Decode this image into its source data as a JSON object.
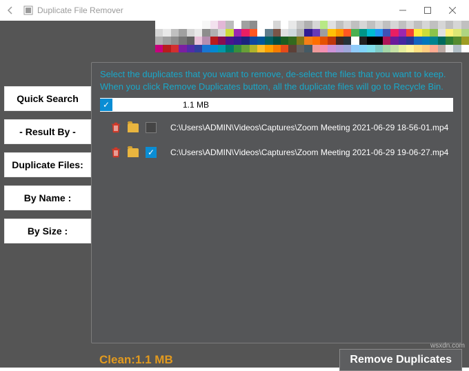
{
  "titlebar": {
    "title": "Duplicate File Remover"
  },
  "sidebar": {
    "items": [
      {
        "label": "Quick Search"
      },
      {
        "label": "- Result By -"
      },
      {
        "label": "Duplicate Files:"
      },
      {
        "label": "By Name :"
      },
      {
        "label": "By Size :"
      }
    ]
  },
  "panel": {
    "instructions": "Select the duplicates that you want to remove, de-select the files that you want to keep. When you click Remove Duplicates button, all the duplicate files will go to Recycle Bin.",
    "group": {
      "checked": true,
      "size": "1.1 MB",
      "files": [
        {
          "path": "C:\\Users\\ADMIN\\Videos\\Captures\\Zoom Meeting 2021-06-29 18-56-01.mp4",
          "marked": false
        },
        {
          "path": "C:\\Users\\ADMIN\\Videos\\Captures\\Zoom Meeting 2021-06-29 19-06-27.mp4",
          "marked": true
        }
      ]
    }
  },
  "footer": {
    "clean_label": "Clean:1.1 MB",
    "remove_label": "Remove Duplicates"
  },
  "watermark": "wsxdn.com",
  "mosaic_colors": [
    "#fff",
    "#fff",
    "#fff",
    "#fff",
    "#fff",
    "#fff",
    "#f7f7f7",
    "#f3e1ee",
    "#e2b7d7",
    "#bbbbbb",
    "#fff",
    "#a0a0a0",
    "#8d8d8d",
    "#fff",
    "#fff",
    "#d6d6d6",
    "#fff",
    "#e8e8e8",
    "#c9c9c9",
    "#b0b0b0",
    "#d6d6d6",
    "#b8e986",
    "#e0e0e0",
    "#c0c0c0",
    "#d6d6d6",
    "#c0c0c0",
    "#d6d6d6",
    "#c0c0c0",
    "#d6d6d6",
    "#c0c0c0",
    "#d6d6d6",
    "#c0c0c0",
    "#d6d6d6",
    "#c0c0c0",
    "#d6d6d6",
    "#c0c0c0",
    "#d6d6d6",
    "#c0c0c0",
    "#d6d6d6",
    "#c0c0c0",
    "#d6d6d6",
    "#e8e8e8",
    "#c0c0c0",
    "#a0a0a0",
    "#d6d6d6",
    "#e8e8e8",
    "#8d8d8d",
    "#b0b0b0",
    "#d6d6d6",
    "#cddc39",
    "#9c27b0",
    "#e91e63",
    "#ff5722",
    "#fff",
    "#607d8b",
    "#795548",
    "#e0e0e0",
    "#cfd8dc",
    "#b0b0b0",
    "#311b92",
    "#673ab7",
    "#9e9e9e",
    "#ffc107",
    "#ff9800",
    "#ff5722",
    "#4caf50",
    "#009688",
    "#00bcd4",
    "#2196f3",
    "#3f51b5",
    "#e91e63",
    "#9c27b0",
    "#f44336",
    "#ffeb3b",
    "#cddc39",
    "#8bc34a",
    "#e0e0e0",
    "#fff176",
    "#dce775",
    "#aed581",
    "#b0b0b0",
    "#9e9e9e",
    "#8d8d8d",
    "#757575",
    "#616161",
    "#e8c0d8",
    "#b58db0",
    "#b71c1c",
    "#880e4f",
    "#4a148c",
    "#311b92",
    "#1a237e",
    "#0d47a1",
    "#01579b",
    "#006064",
    "#004d40",
    "#1b5e20",
    "#33691e",
    "#827717",
    "#f57f17",
    "#ff6f00",
    "#e65100",
    "#bf360c",
    "#3e2723",
    "#263238",
    "#fff",
    "#212121",
    "#000",
    "#000",
    "#ad1457",
    "#6a1b9a",
    "#4527a0",
    "#283593",
    "#1565c0",
    "#0277bd",
    "#00838f",
    "#00695c",
    "#2e7d32",
    "#558b2f",
    "#9e9d24",
    "#c6007d",
    "#b71c1c",
    "#d32f2f",
    "#7b1fa2",
    "#512da8",
    "#303f9f",
    "#1976d2",
    "#0288d1",
    "#0097a7",
    "#00796b",
    "#388e3c",
    "#689f38",
    "#afb42b",
    "#fbc02d",
    "#ffa000",
    "#f57c00",
    "#e64a19",
    "#5d4037",
    "#616161",
    "#455a64",
    "#ef9a9a",
    "#f48fb1",
    "#ce93d8",
    "#b39ddb",
    "#9fa8da",
    "#90caf9",
    "#81d4fa",
    "#80deea",
    "#80cbc4",
    "#a5d6a7",
    "#c5e1a5",
    "#e6ee9c",
    "#fff59d",
    "#ffe082",
    "#ffcc80",
    "#ffab91",
    "#bcaaa4",
    "#eee",
    "#b0bec5",
    "#fff",
    "#555",
    "#555",
    "#555",
    "#555",
    "#555",
    "#555",
    "#555",
    "#555",
    "#555",
    "#555",
    "#555",
    "#555",
    "#555",
    "#555",
    "#555",
    "#555",
    "#555",
    "#555",
    "#555",
    "#555",
    "#555",
    "#555",
    "#555",
    "#555",
    "#555",
    "#555",
    "#555",
    "#555",
    "#555",
    "#555",
    "#555",
    "#555",
    "#555",
    "#555",
    "#555",
    "#555",
    "#555",
    "#555",
    "#555",
    "#555"
  ]
}
